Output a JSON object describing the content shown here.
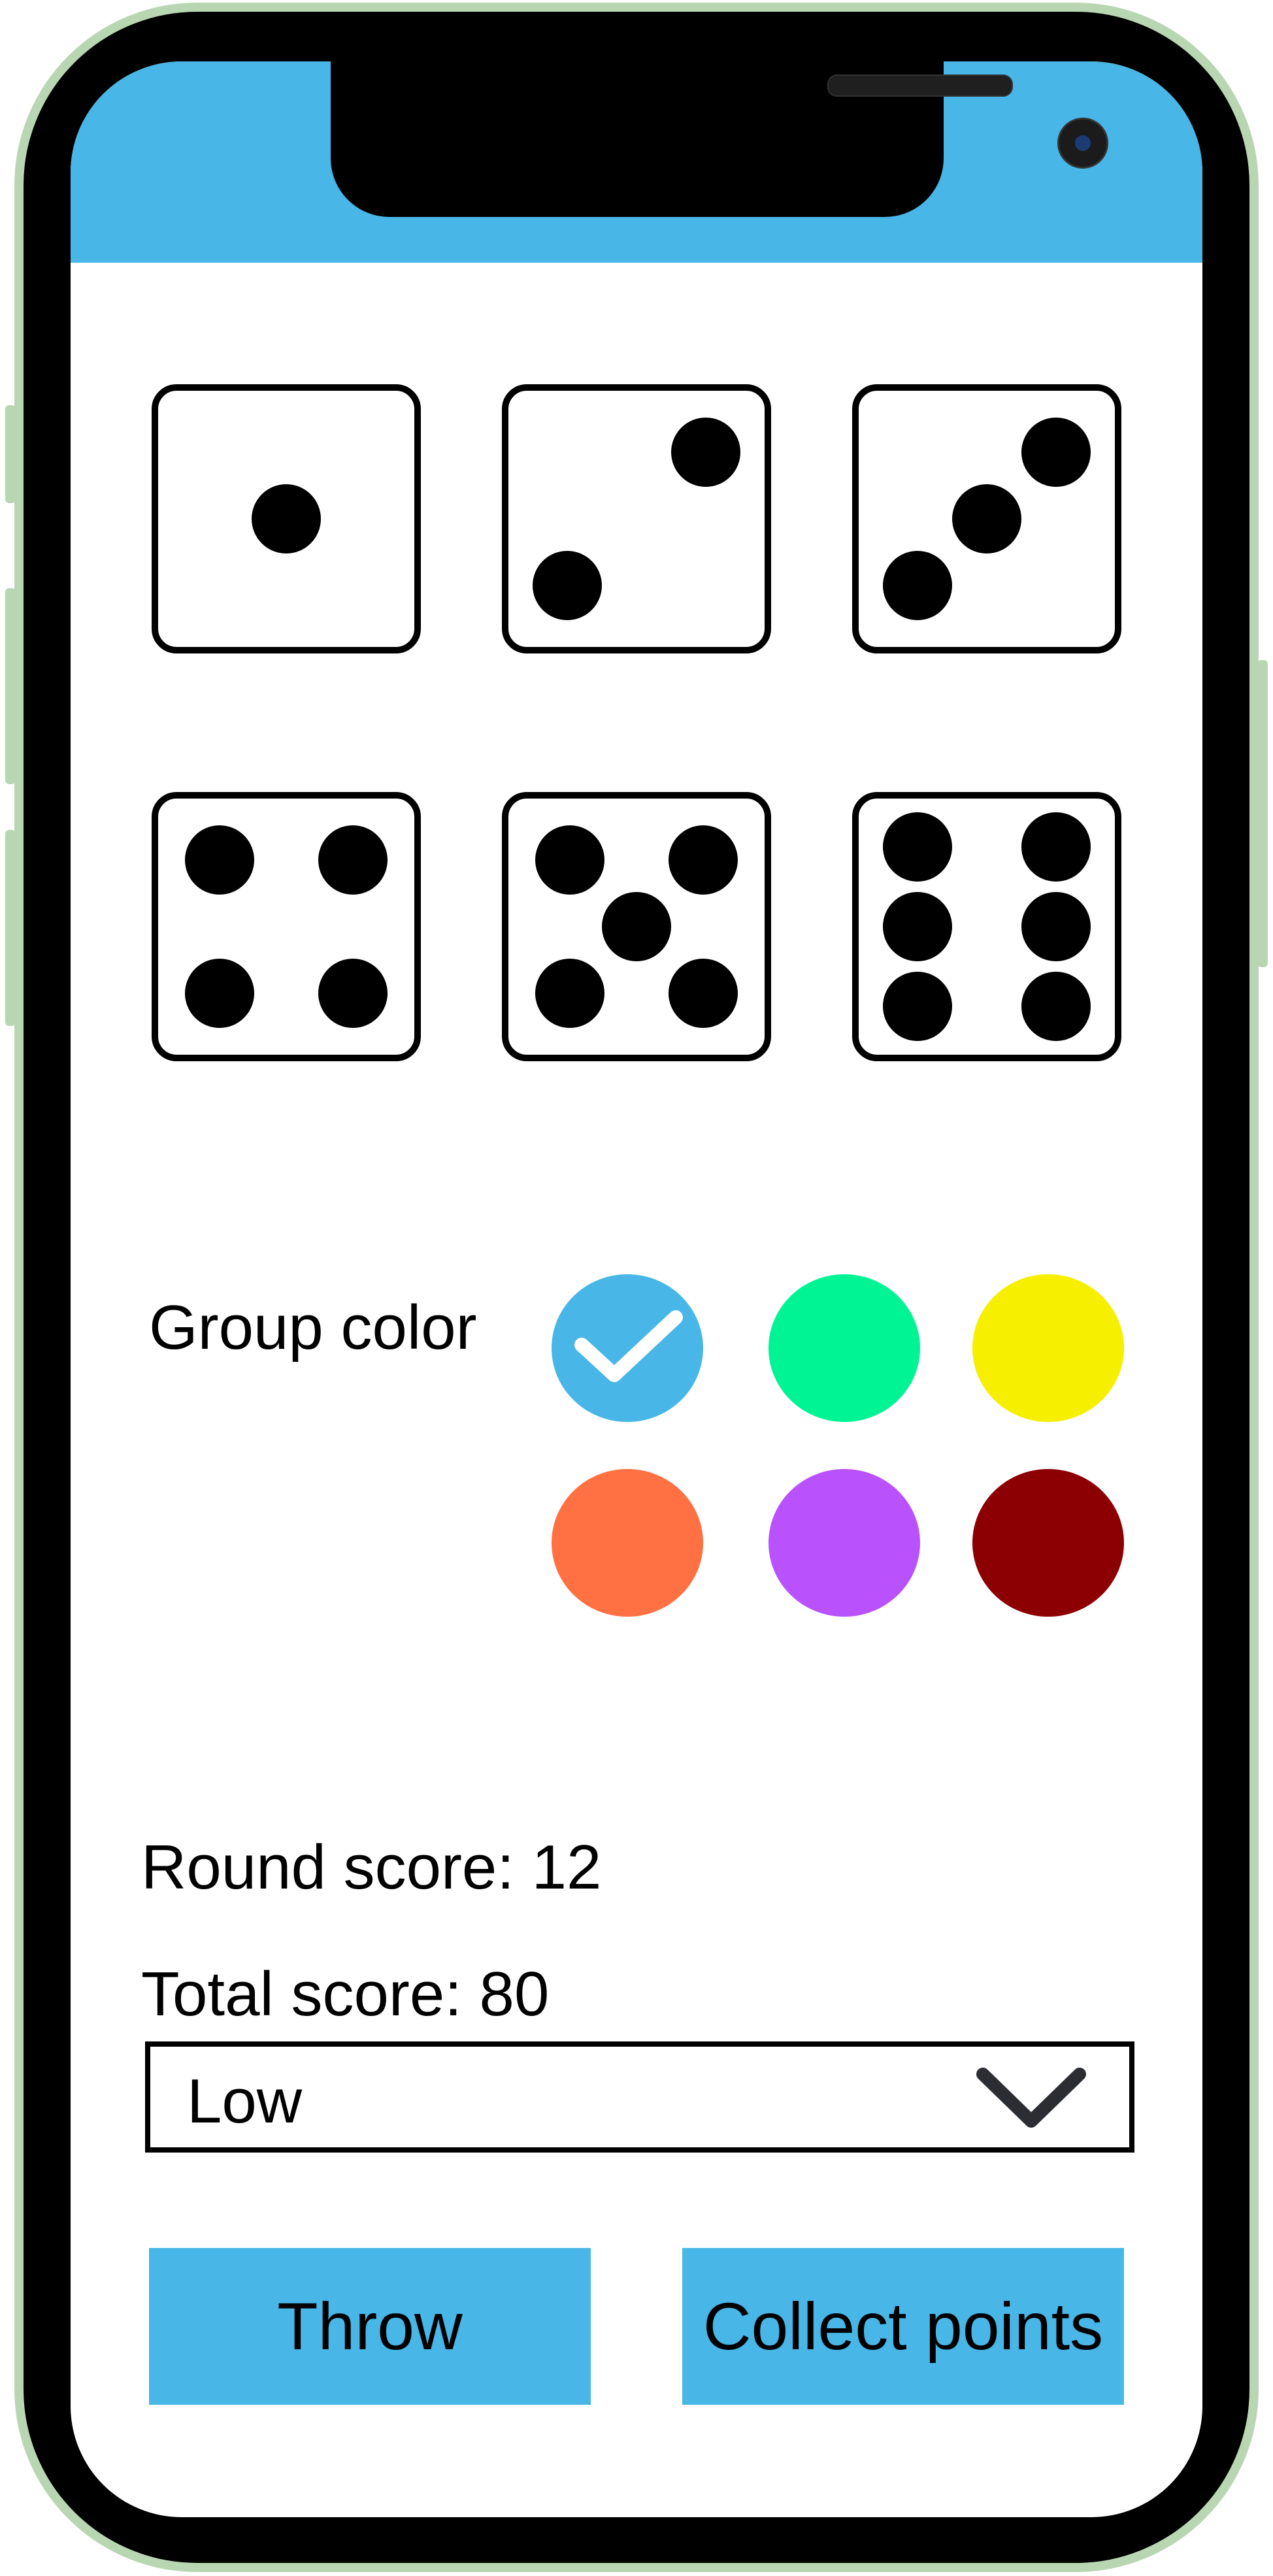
{
  "dice": [
    {
      "face": 1
    },
    {
      "face": 2
    },
    {
      "face": 3
    },
    {
      "face": 4
    },
    {
      "face": 5
    },
    {
      "face": 6
    }
  ],
  "group_color": {
    "label": "Group color",
    "selected_index": 0,
    "options": [
      {
        "color": "#48b6e6",
        "selected": true
      },
      {
        "color": "#00f494",
        "selected": false
      },
      {
        "color": "#f6ef00",
        "selected": false
      },
      {
        "color": "#ff7043",
        "selected": false
      },
      {
        "color": "#b952fd",
        "selected": false
      },
      {
        "color": "#8c0003",
        "selected": false
      }
    ]
  },
  "scores": {
    "round": "Round score: 12",
    "total": "Total score: 80"
  },
  "dropdown": {
    "selected": "Low",
    "icon": "chevron-down-icon"
  },
  "buttons": {
    "throw": "Throw",
    "collect": "Collect points"
  },
  "colors": {
    "accent": "#48b6e6",
    "frame_border": "#b9d6b3"
  }
}
